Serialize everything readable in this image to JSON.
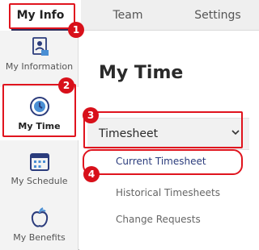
{
  "tabs": [
    {
      "label": "My Info",
      "active": true
    },
    {
      "label": "Team",
      "active": false
    },
    {
      "label": "Settings",
      "active": false
    }
  ],
  "sidebar": {
    "items": [
      {
        "label": "My Information",
        "icon": "id-card-icon",
        "active": false
      },
      {
        "label": "My Time",
        "icon": "clock-icon",
        "active": true
      },
      {
        "label": "My Schedule",
        "icon": "calendar-icon",
        "active": false
      },
      {
        "label": "My Benefits",
        "icon": "apple-icon",
        "active": false
      }
    ]
  },
  "main": {
    "title": "My Time",
    "accordion": {
      "label": "Timesheet",
      "expanded": true,
      "items": [
        {
          "label": "Current Timesheet"
        },
        {
          "label": "Historical Timesheets"
        },
        {
          "label": "Change Requests"
        }
      ]
    }
  },
  "annotations": [
    "1",
    "2",
    "3",
    "4"
  ],
  "colors": {
    "accent": "#2b3c7c",
    "highlight": "#e0141e",
    "navy": "#2b2b5a"
  }
}
